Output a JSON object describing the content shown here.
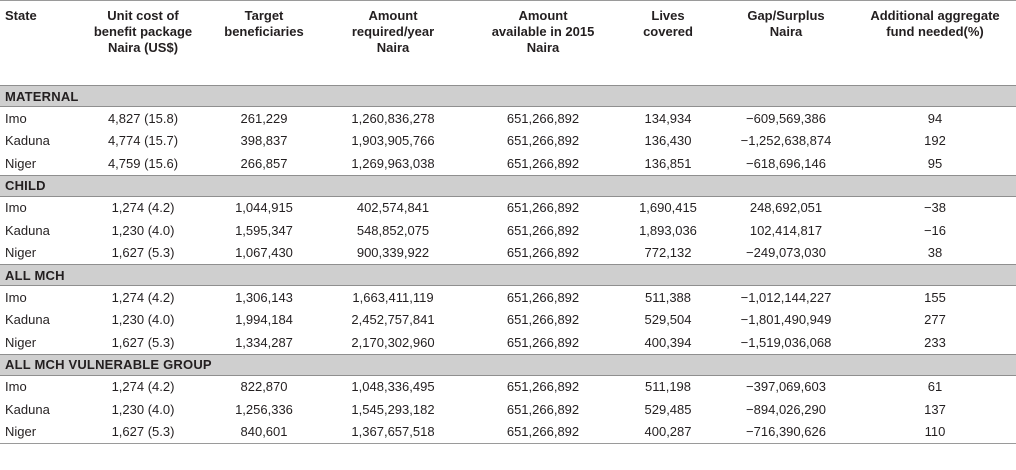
{
  "columns": [
    "State",
    "Unit cost of\nbenefit package\nNaira (US$)",
    "Target\nbeneficiaries",
    "Amount\nrequired/year\nNaira",
    "Amount\navailable in 2015\nNaira",
    "Lives\ncovered",
    "Gap/Surplus\nNaira",
    "Additional aggregate\nfund needed(%)"
  ],
  "sections": [
    {
      "title": "MATERNAL",
      "rows": [
        [
          "Imo",
          "4,827 (15.8)",
          "261,229",
          "1,260,836,278",
          "651,266,892",
          "134,934",
          "−609,569,386",
          "94"
        ],
        [
          "Kaduna",
          "4,774 (15.7)",
          "398,837",
          "1,903,905,766",
          "651,266,892",
          "136,430",
          "−1,252,638,874",
          "192"
        ],
        [
          "Niger",
          "4,759 (15.6)",
          "266,857",
          "1,269,963,038",
          "651,266,892",
          "136,851",
          "−618,696,146",
          "95"
        ]
      ]
    },
    {
      "title": "CHILD",
      "rows": [
        [
          "Imo",
          "1,274 (4.2)",
          "1,044,915",
          "402,574,841",
          "651,266,892",
          "1,690,415",
          "248,692,051",
          "−38"
        ],
        [
          "Kaduna",
          "1,230 (4.0)",
          "1,595,347",
          "548,852,075",
          "651,266,892",
          "1,893,036",
          "102,414,817",
          "−16"
        ],
        [
          "Niger",
          "1,627 (5.3)",
          "1,067,430",
          "900,339,922",
          "651,266,892",
          "772,132",
          "−249,073,030",
          "38"
        ]
      ]
    },
    {
      "title": "ALL MCH",
      "rows": [
        [
          "Imo",
          "1,274 (4.2)",
          "1,306,143",
          "1,663,411,119",
          "651,266,892",
          "511,388",
          "−1,012,144,227",
          "155"
        ],
        [
          "Kaduna",
          "1,230 (4.0)",
          "1,994,184",
          "2,452,757,841",
          "651,266,892",
          "529,504",
          "−1,801,490,949",
          "277"
        ],
        [
          "Niger",
          "1,627 (5.3)",
          "1,334,287",
          "2,170,302,960",
          "651,266,892",
          "400,394",
          "−1,519,036,068",
          "233"
        ]
      ]
    },
    {
      "title": "ALL MCH VULNERABLE GROUP",
      "rows": [
        [
          "Imo",
          "1,274 (4.2)",
          "822,870",
          "1,048,336,495",
          "651,266,892",
          "511,198",
          "−397,069,603",
          "61"
        ],
        [
          "Kaduna",
          "1,230 (4.0)",
          "1,256,336",
          "1,545,293,182",
          "651,266,892",
          "529,485",
          "−894,026,290",
          "137"
        ],
        [
          "Niger",
          "1,627 (5.3)",
          "840,601",
          "1,367,657,518",
          "651,266,892",
          "400,287",
          "−716,390,626",
          "110"
        ]
      ]
    }
  ]
}
